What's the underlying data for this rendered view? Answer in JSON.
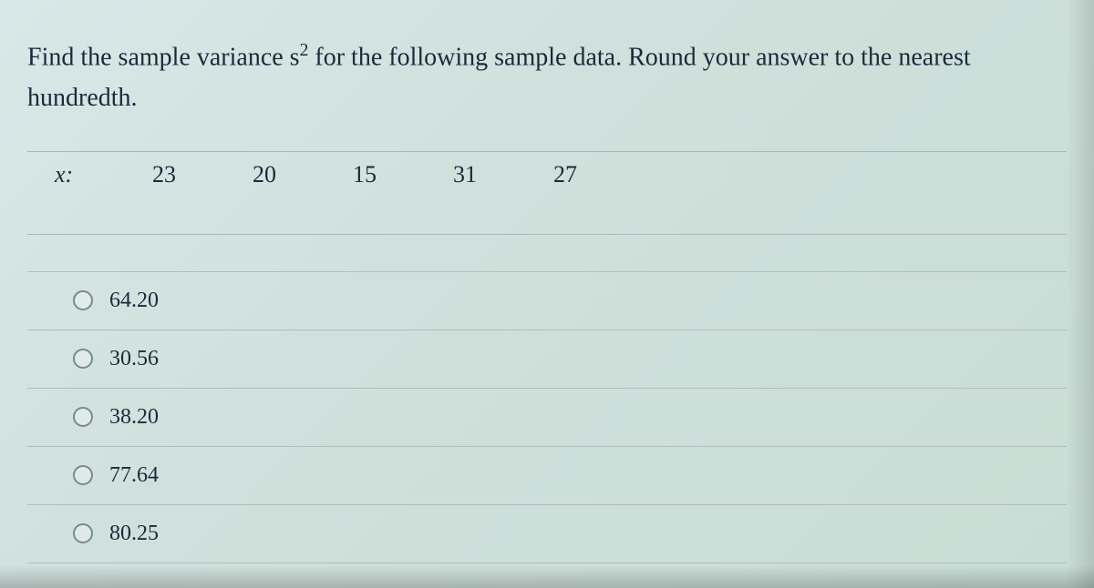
{
  "question": {
    "text_part1": "Find the sample variance s",
    "super": "2",
    "text_part2": " for the following sample data. Round your answer to the nearest hundredth."
  },
  "data_label": "x:",
  "data_values": [
    "23",
    "20",
    "15",
    "31",
    "27"
  ],
  "answers": [
    {
      "label": "64.20"
    },
    {
      "label": "30.56"
    },
    {
      "label": "38.20"
    },
    {
      "label": "77.64"
    },
    {
      "label": "80.25"
    }
  ]
}
